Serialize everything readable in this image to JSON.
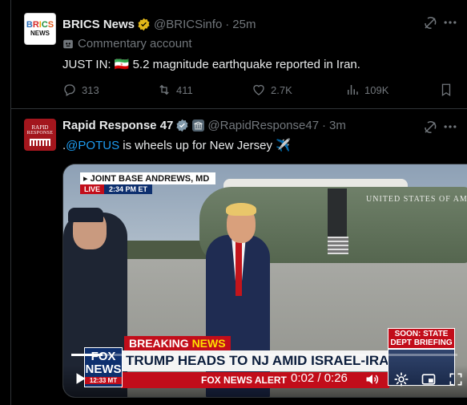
{
  "posts": [
    {
      "display_name": "BRICS News",
      "handle": "@BRICSinfo",
      "time": "25m",
      "logo_line1": "BRICS",
      "logo_line2": "NEWS",
      "account_note": "Commentary account",
      "text_prefix": "JUST IN: ",
      "flag": "🇮🇷",
      "text_body": " 5.2 magnitude earthquake reported in Iran.",
      "stats": {
        "replies": "313",
        "reposts": "411",
        "likes": "2.7K",
        "views": "109K"
      }
    },
    {
      "display_name": "Rapid Response 47",
      "handle": "@RapidResponse47",
      "time": "3m",
      "logo_line1": "RAPID",
      "logo_line2": "RESPONSE",
      "text_prefix": ".",
      "mention": "@POTUS",
      "text_body": " is wheels up for New Jersey ✈️",
      "video": {
        "location": "JOINT BASE ANDREWS, MD",
        "live_label": "LIVE",
        "live_time": "2:34 PM ET",
        "helicopter_text": "UNITED STATES OF AM",
        "breaking_label_1": "BREAKING ",
        "breaking_label_2": "NEWS",
        "headline": "TRUMP HEADS TO NJ AMID ISRAEL-IRAN CONFLICT",
        "ticker": "FOX NEWS ALERT",
        "logo_fox": "FOX",
        "logo_news": "NEWS",
        "logo_time": "12:33 MT",
        "side_label": "SOON: STATE DEPT BRIEFING",
        "time_display": "0:02 / 0:26",
        "progress": 0.08
      }
    }
  ],
  "colors": {
    "background": "#000000",
    "text": "#e7e9ea",
    "muted": "#71767b",
    "link": "#1d9bf0",
    "verified_gold": "#e2b719",
    "verified_gray": "#829aab"
  },
  "icons": [
    "grok-icon",
    "more-icon",
    "reply-icon",
    "repost-icon",
    "like-icon",
    "views-icon",
    "bookmark-icon",
    "play-icon",
    "volume-icon",
    "settings-icon",
    "pip-icon",
    "fullscreen-icon"
  ]
}
